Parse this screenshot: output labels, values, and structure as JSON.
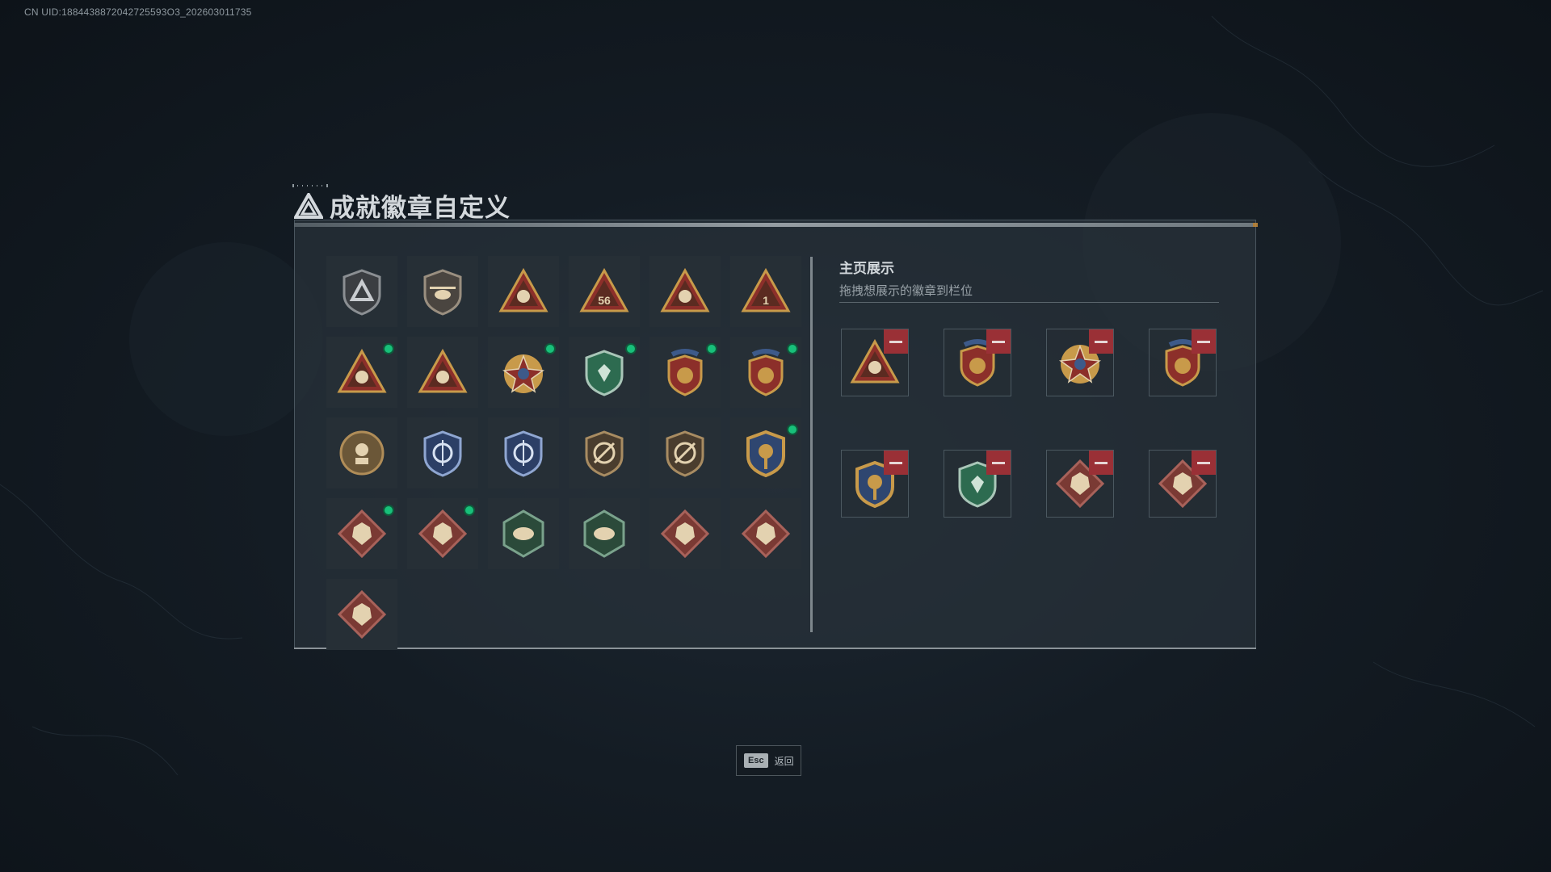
{
  "uid_text": "CN UID:1884438872042725593O3_202603011735",
  "title": "成就徽章自定义",
  "showcase": {
    "title": "主页展示",
    "subtitle": "拖拽想展示的徽章到栏位"
  },
  "colors": {
    "accent_green": "#18c07a",
    "remove_red": "#9a3036",
    "gold": "#c89a4a"
  },
  "badges": [
    {
      "icon": "shield-triangle-icon",
      "new": false
    },
    {
      "icon": "helicopter-shield-icon",
      "new": false
    },
    {
      "icon": "radar-triangle-icon",
      "new": false
    },
    {
      "icon": "triangle-56-icon",
      "new": false,
      "label": "56"
    },
    {
      "icon": "boat-triangle-icon",
      "new": false
    },
    {
      "icon": "triangle-number-1-icon",
      "new": false,
      "label": "1"
    },
    {
      "icon": "supply-box-triangle-icon",
      "new": true
    },
    {
      "icon": "soldiers-triangle-icon",
      "new": false
    },
    {
      "icon": "star-medal-icon",
      "new": true
    },
    {
      "icon": "green-shield-medal-icon",
      "new": true
    },
    {
      "icon": "red-shield-medal-icon",
      "new": true
    },
    {
      "icon": "red-shield-medal-alt-icon",
      "new": true
    },
    {
      "icon": "soldier-round-emblem-icon",
      "new": false
    },
    {
      "icon": "blue-crosshair-shield-icon",
      "new": false
    },
    {
      "icon": "blue-crosshair-shield-alt-icon",
      "new": false
    },
    {
      "icon": "rifle-shield-icon",
      "new": false
    },
    {
      "icon": "rifle-shield-alt-icon",
      "new": false
    },
    {
      "icon": "gold-anchor-shield-icon",
      "new": true
    },
    {
      "icon": "wolf-diamond-icon",
      "new": true
    },
    {
      "icon": "wolf-diamond-alt-icon",
      "new": true
    },
    {
      "icon": "wasp-hexagon-icon",
      "new": false
    },
    {
      "icon": "gun-hexagon-icon",
      "new": false
    },
    {
      "icon": "dragon-diamond-icon",
      "new": false
    },
    {
      "icon": "dragon-diamond-alt-icon",
      "new": false
    },
    {
      "icon": "runner-diamond-icon",
      "new": false
    }
  ],
  "slots": [
    {
      "icon": "supply-box-triangle-icon"
    },
    {
      "icon": "red-shield-medal-icon"
    },
    {
      "icon": "star-medal-icon"
    },
    {
      "icon": "red-shield-medal-alt-icon"
    },
    {
      "icon": "gold-anchor-shield-icon"
    },
    {
      "icon": "green-shield-medal-icon"
    },
    {
      "icon": "wolf-diamond-icon"
    },
    {
      "icon": "wolf-diamond-alt-icon"
    }
  ],
  "esc": {
    "key": "Esc",
    "label": "返回"
  }
}
